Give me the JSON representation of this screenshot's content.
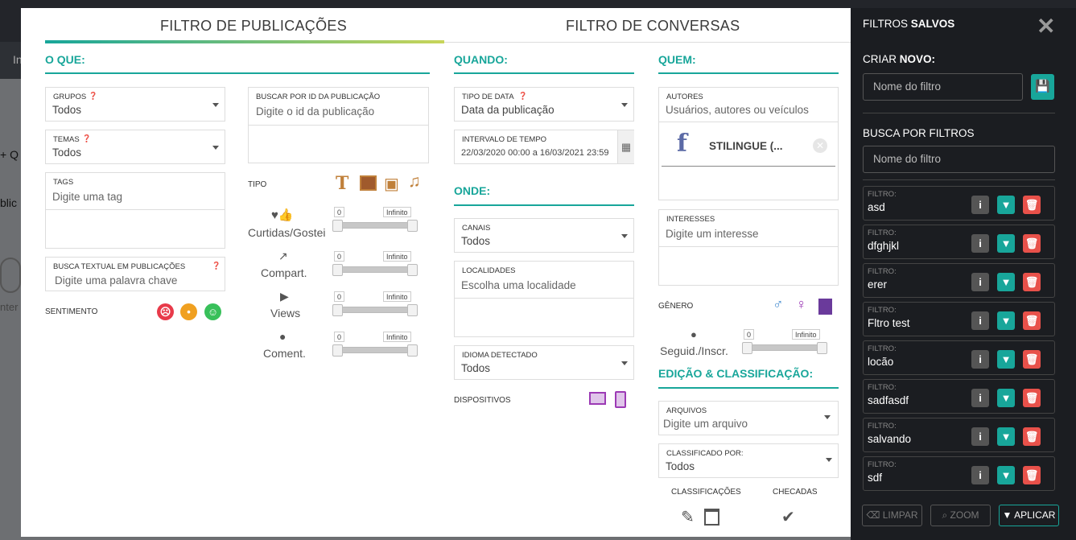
{
  "background": {
    "tab_partial": "In",
    "side_add": "+ Q",
    "side_pub": "blic",
    "side_int": "nter",
    "top_right": "es",
    "right_side": "e",
    "right_side2": "o"
  },
  "tabs": {
    "publicacoes": "FILTRO DE PUBLICAÇÕES",
    "conversas": "FILTRO DE CONVERSAS"
  },
  "o_que": {
    "title": "O QUE:",
    "grupos": {
      "label": "GRUPOS",
      "value": "Todos"
    },
    "temas": {
      "label": "TEMAS",
      "value": "Todos"
    },
    "tags": {
      "label": "TAGS",
      "placeholder": "Digite uma tag"
    },
    "busca_textual": {
      "label": "BUSCA TEXTUAL EM PUBLICAÇÕES",
      "placeholder": "Digite uma palavra chave"
    },
    "sentimento": "SENTIMENTO",
    "buscar_id": {
      "label": "BUSCAR POR ID DA PUBLICAÇÃO",
      "placeholder": "Digite o id da publicação"
    },
    "tipo": "TIPO",
    "metrics": [
      {
        "icon": "heart-thumbs-icon",
        "label": "Curtidas/Gostei",
        "min": "0",
        "max": "Infinito"
      },
      {
        "icon": "share-icon",
        "label": "Compart.",
        "min": "0",
        "max": "Infinito"
      },
      {
        "icon": "play-icon",
        "label": "Views",
        "min": "0",
        "max": "Infinito"
      },
      {
        "icon": "comment-icon",
        "label": "Coment.",
        "min": "0",
        "max": "Infinito"
      }
    ]
  },
  "quando": {
    "title": "QUANDO:",
    "tipo_data": {
      "label": "TIPO DE DATA",
      "value": "Data da publicação"
    },
    "intervalo": {
      "label": "INTERVALO DE TEMPO",
      "value": "22/03/2020 00:00 a 16/03/2021 23:59"
    }
  },
  "onde": {
    "title": "ONDE:",
    "canais": {
      "label": "CANAIS",
      "value": "Todos"
    },
    "localidades": {
      "label": "LOCALIDADES",
      "placeholder": "Escolha uma localidade"
    },
    "idioma": {
      "label": "IDIOMA DETECTADO",
      "value": "Todos"
    },
    "dispositivos": "DISPOSITIVOS"
  },
  "quem": {
    "title": "QUEM:",
    "autores": {
      "label": "AUTORES",
      "placeholder": "Usuários, autores ou veículos",
      "chip": "STILINGUE (..."
    },
    "interesses": {
      "label": "INTERESSES",
      "placeholder": "Digite um interesse"
    },
    "genero": "GÊNERO",
    "seguid": {
      "label": "Seguid./Inscr.",
      "min": "0",
      "max": "Infinito"
    }
  },
  "edicao": {
    "title": "EDIÇÃO & CLASSIFICAÇÃO:",
    "arquivos": {
      "label": "ARQUIVOS",
      "placeholder": "Digite um arquivo"
    },
    "classificado": {
      "label": "CLASSIFICADO POR:",
      "value": "Todos"
    },
    "classificacoes": "CLASSIFICAÇÕES",
    "checadas": "CHECADAS"
  },
  "panel": {
    "title_a": "FILTROS ",
    "title_b": "SALVOS",
    "criar_a": "CRIAR ",
    "criar_b": "NOVO:",
    "nome_placeholder": "Nome do filtro",
    "busca_title": "BUSCA POR FILTROS",
    "busca_placeholder": "Nome do filtro",
    "filtro_label": "FILTRO:",
    "filters": [
      "asd",
      "dfghjkl",
      "erer",
      "Fltro test",
      "locão",
      "sadfasdf",
      "salvando",
      "sdf"
    ],
    "limpar": "LIMPAR",
    "zoom": "ZOOM",
    "aplicar": "APLICAR"
  },
  "colors": {
    "accent": "#18a69a",
    "danger": "#e8514a",
    "dark": "#1b1d21"
  }
}
